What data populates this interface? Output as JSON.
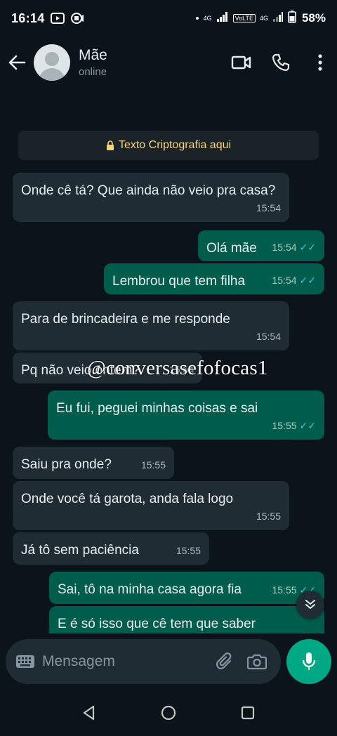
{
  "status_bar": {
    "time": "16:14",
    "network_label_1": "4G",
    "volte_label": "VoLTE",
    "network_label_2": "4G",
    "battery": "58%"
  },
  "header": {
    "contact_name": "Mãe",
    "contact_status": "online",
    "icons": [
      "back-arrow-icon",
      "video-call-icon",
      "phone-icon",
      "more-options-icon"
    ]
  },
  "chat": {
    "encryption_notice": "Texto Criptografia aqui",
    "watermark": "@conversasefofocas1",
    "messages": [
      {
        "direction": "in",
        "text": "Onde cê tá? Que ainda não veio pra casa?",
        "time": "15:54"
      },
      {
        "direction": "out",
        "text": "Olá mãe",
        "time": "15:54",
        "read": true
      },
      {
        "direction": "out",
        "text": "Lembrou que tem filha",
        "time": "15:54",
        "read": true
      },
      {
        "direction": "in",
        "text": "Para de brincadeira e me responde",
        "time": "15:54"
      },
      {
        "direction": "in",
        "text": "Pq não veio ontem?",
        "time": "15:54"
      },
      {
        "direction": "out",
        "text": "Eu fui, peguei minhas coisas e sai",
        "time": "15:55",
        "read": true
      },
      {
        "direction": "in",
        "text": "Saiu pra onde?",
        "time": "15:55"
      },
      {
        "direction": "in",
        "text": "Onde você tá garota, anda fala logo",
        "time": "15:55"
      },
      {
        "direction": "in",
        "text": "Já tô sem paciência",
        "time": "15:55"
      },
      {
        "direction": "out",
        "text": "Sai, tô na minha casa agora fia",
        "time": "15:55",
        "read": true
      },
      {
        "direction": "out",
        "text": "E é só isso que cê tem que saber",
        "time": ""
      }
    ]
  },
  "composer": {
    "placeholder": "Mensagem"
  },
  "colors": {
    "background": "#0b141a",
    "incoming_bubble": "#1f2c33",
    "outgoing_bubble": "#005c4b",
    "accent": "#00a884",
    "read_check": "#53bdeb",
    "encryption_text": "#f7d17a"
  }
}
